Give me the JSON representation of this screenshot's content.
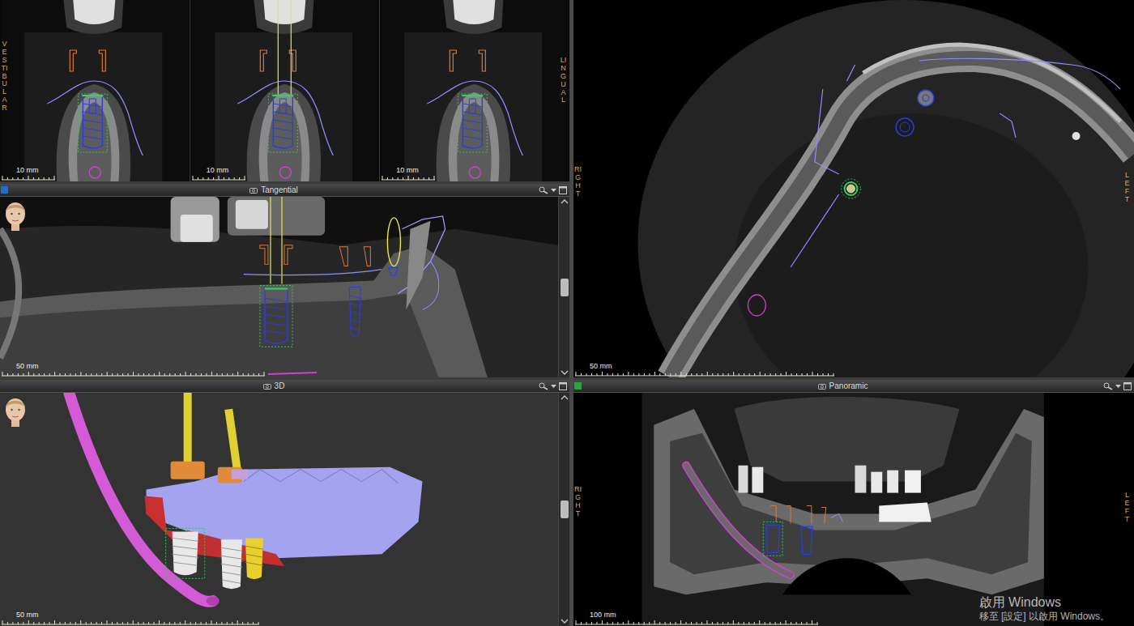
{
  "cross_sections": {
    "left_label": "VESTIBULAR",
    "right_label": "LINGUAL",
    "slices": [
      {
        "scale": "10 mm",
        "selected": false
      },
      {
        "scale": "10 mm",
        "selected": true
      },
      {
        "scale": "10 mm",
        "selected": false
      }
    ]
  },
  "tangential": {
    "title": "Tangential",
    "scale": "50 mm",
    "active": true,
    "marker_color": "#1f6fd1"
  },
  "axial": {
    "left_label": "RIGHT",
    "right_label": "LEFT",
    "scale": "50 mm"
  },
  "view_3d": {
    "title": "3D",
    "scale": "50 mm",
    "active": false,
    "marker_color": "#1f6fd1"
  },
  "panoramic": {
    "title": "Panoramic",
    "left_label": "RIGHT",
    "right_label": "LEFT",
    "scale": "100 mm",
    "active": true,
    "marker_color": "#22a83a"
  },
  "watermark": {
    "title": "啟用 Windows",
    "subtitle": "移至 [設定] 以啟用 Windows。"
  }
}
